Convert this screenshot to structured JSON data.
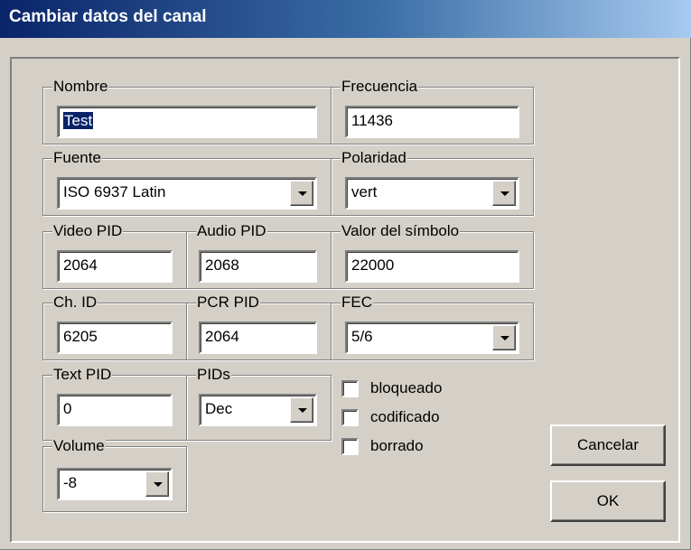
{
  "window": {
    "title": "Cambiar datos del canal"
  },
  "fields": {
    "nombre": {
      "label": "Nombre",
      "value_selected": "Test"
    },
    "frecuencia": {
      "label": "Frecuencia",
      "value": "11436"
    },
    "fuente": {
      "label": "Fuente",
      "value": "ISO 6937 Latin"
    },
    "polaridad": {
      "label": "Polaridad",
      "value": "vert"
    },
    "video_pid": {
      "label": "Video PID",
      "value": "2064"
    },
    "audio_pid": {
      "label": "Audio PID",
      "value": "2068"
    },
    "valor_simbolo": {
      "label": "Valor del símbolo",
      "value": "22000"
    },
    "ch_id": {
      "label": "Ch. ID",
      "value": "6205"
    },
    "pcr_pid": {
      "label": "PCR PID",
      "value": "2064"
    },
    "fec": {
      "label": "FEC",
      "value": "5/6"
    },
    "text_pid": {
      "label": "Text PID",
      "value": "0"
    },
    "pids": {
      "label": "PIDs",
      "value": "Dec"
    },
    "volume": {
      "label": "Volume",
      "value": "-8"
    }
  },
  "checkboxes": [
    {
      "label": "bloqueado",
      "checked": false
    },
    {
      "label": "codificado",
      "checked": false
    },
    {
      "label": "borrado",
      "checked": false
    }
  ],
  "buttons": {
    "cancel": "Cancelar",
    "ok": "OK"
  },
  "colors": {
    "face": "#d4d0c8",
    "title_start": "#0a246a",
    "title_end": "#a6caf0",
    "selection": "#0a246a"
  }
}
